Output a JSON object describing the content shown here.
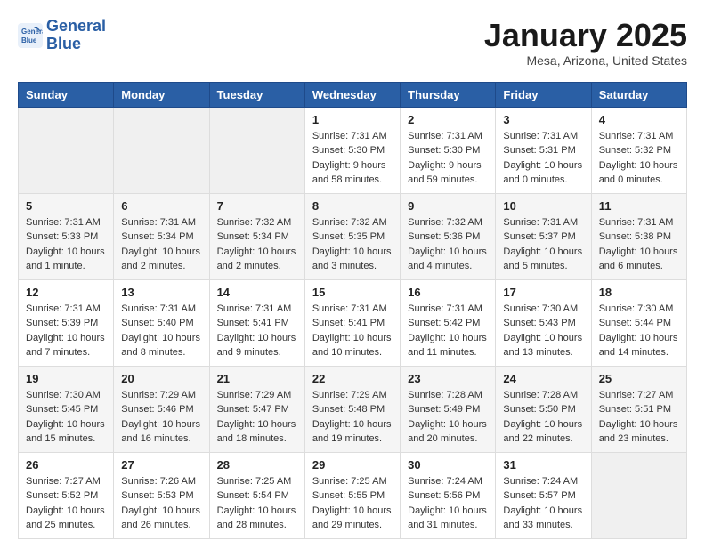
{
  "header": {
    "logo_line1": "General",
    "logo_line2": "Blue",
    "title": "January 2025",
    "subtitle": "Mesa, Arizona, United States"
  },
  "days_of_week": [
    "Sunday",
    "Monday",
    "Tuesday",
    "Wednesday",
    "Thursday",
    "Friday",
    "Saturday"
  ],
  "weeks": [
    [
      {
        "day": "",
        "empty": true
      },
      {
        "day": "",
        "empty": true
      },
      {
        "day": "",
        "empty": true
      },
      {
        "day": "1",
        "sunrise": "7:31 AM",
        "sunset": "5:30 PM",
        "daylight": "9 hours and 58 minutes."
      },
      {
        "day": "2",
        "sunrise": "7:31 AM",
        "sunset": "5:30 PM",
        "daylight": "9 hours and 59 minutes."
      },
      {
        "day": "3",
        "sunrise": "7:31 AM",
        "sunset": "5:31 PM",
        "daylight": "10 hours and 0 minutes."
      },
      {
        "day": "4",
        "sunrise": "7:31 AM",
        "sunset": "5:32 PM",
        "daylight": "10 hours and 0 minutes."
      }
    ],
    [
      {
        "day": "5",
        "sunrise": "7:31 AM",
        "sunset": "5:33 PM",
        "daylight": "10 hours and 1 minute."
      },
      {
        "day": "6",
        "sunrise": "7:31 AM",
        "sunset": "5:34 PM",
        "daylight": "10 hours and 2 minutes."
      },
      {
        "day": "7",
        "sunrise": "7:32 AM",
        "sunset": "5:34 PM",
        "daylight": "10 hours and 2 minutes."
      },
      {
        "day": "8",
        "sunrise": "7:32 AM",
        "sunset": "5:35 PM",
        "daylight": "10 hours and 3 minutes."
      },
      {
        "day": "9",
        "sunrise": "7:32 AM",
        "sunset": "5:36 PM",
        "daylight": "10 hours and 4 minutes."
      },
      {
        "day": "10",
        "sunrise": "7:31 AM",
        "sunset": "5:37 PM",
        "daylight": "10 hours and 5 minutes."
      },
      {
        "day": "11",
        "sunrise": "7:31 AM",
        "sunset": "5:38 PM",
        "daylight": "10 hours and 6 minutes."
      }
    ],
    [
      {
        "day": "12",
        "sunrise": "7:31 AM",
        "sunset": "5:39 PM",
        "daylight": "10 hours and 7 minutes."
      },
      {
        "day": "13",
        "sunrise": "7:31 AM",
        "sunset": "5:40 PM",
        "daylight": "10 hours and 8 minutes."
      },
      {
        "day": "14",
        "sunrise": "7:31 AM",
        "sunset": "5:41 PM",
        "daylight": "10 hours and 9 minutes."
      },
      {
        "day": "15",
        "sunrise": "7:31 AM",
        "sunset": "5:41 PM",
        "daylight": "10 hours and 10 minutes."
      },
      {
        "day": "16",
        "sunrise": "7:31 AM",
        "sunset": "5:42 PM",
        "daylight": "10 hours and 11 minutes."
      },
      {
        "day": "17",
        "sunrise": "7:30 AM",
        "sunset": "5:43 PM",
        "daylight": "10 hours and 13 minutes."
      },
      {
        "day": "18",
        "sunrise": "7:30 AM",
        "sunset": "5:44 PM",
        "daylight": "10 hours and 14 minutes."
      }
    ],
    [
      {
        "day": "19",
        "sunrise": "7:30 AM",
        "sunset": "5:45 PM",
        "daylight": "10 hours and 15 minutes."
      },
      {
        "day": "20",
        "sunrise": "7:29 AM",
        "sunset": "5:46 PM",
        "daylight": "10 hours and 16 minutes."
      },
      {
        "day": "21",
        "sunrise": "7:29 AM",
        "sunset": "5:47 PM",
        "daylight": "10 hours and 18 minutes."
      },
      {
        "day": "22",
        "sunrise": "7:29 AM",
        "sunset": "5:48 PM",
        "daylight": "10 hours and 19 minutes."
      },
      {
        "day": "23",
        "sunrise": "7:28 AM",
        "sunset": "5:49 PM",
        "daylight": "10 hours and 20 minutes."
      },
      {
        "day": "24",
        "sunrise": "7:28 AM",
        "sunset": "5:50 PM",
        "daylight": "10 hours and 22 minutes."
      },
      {
        "day": "25",
        "sunrise": "7:27 AM",
        "sunset": "5:51 PM",
        "daylight": "10 hours and 23 minutes."
      }
    ],
    [
      {
        "day": "26",
        "sunrise": "7:27 AM",
        "sunset": "5:52 PM",
        "daylight": "10 hours and 25 minutes."
      },
      {
        "day": "27",
        "sunrise": "7:26 AM",
        "sunset": "5:53 PM",
        "daylight": "10 hours and 26 minutes."
      },
      {
        "day": "28",
        "sunrise": "7:25 AM",
        "sunset": "5:54 PM",
        "daylight": "10 hours and 28 minutes."
      },
      {
        "day": "29",
        "sunrise": "7:25 AM",
        "sunset": "5:55 PM",
        "daylight": "10 hours and 29 minutes."
      },
      {
        "day": "30",
        "sunrise": "7:24 AM",
        "sunset": "5:56 PM",
        "daylight": "10 hours and 31 minutes."
      },
      {
        "day": "31",
        "sunrise": "7:24 AM",
        "sunset": "5:57 PM",
        "daylight": "10 hours and 33 minutes."
      },
      {
        "day": "",
        "empty": true
      }
    ]
  ],
  "labels": {
    "sunrise": "Sunrise:",
    "sunset": "Sunset:",
    "daylight": "Daylight:"
  }
}
